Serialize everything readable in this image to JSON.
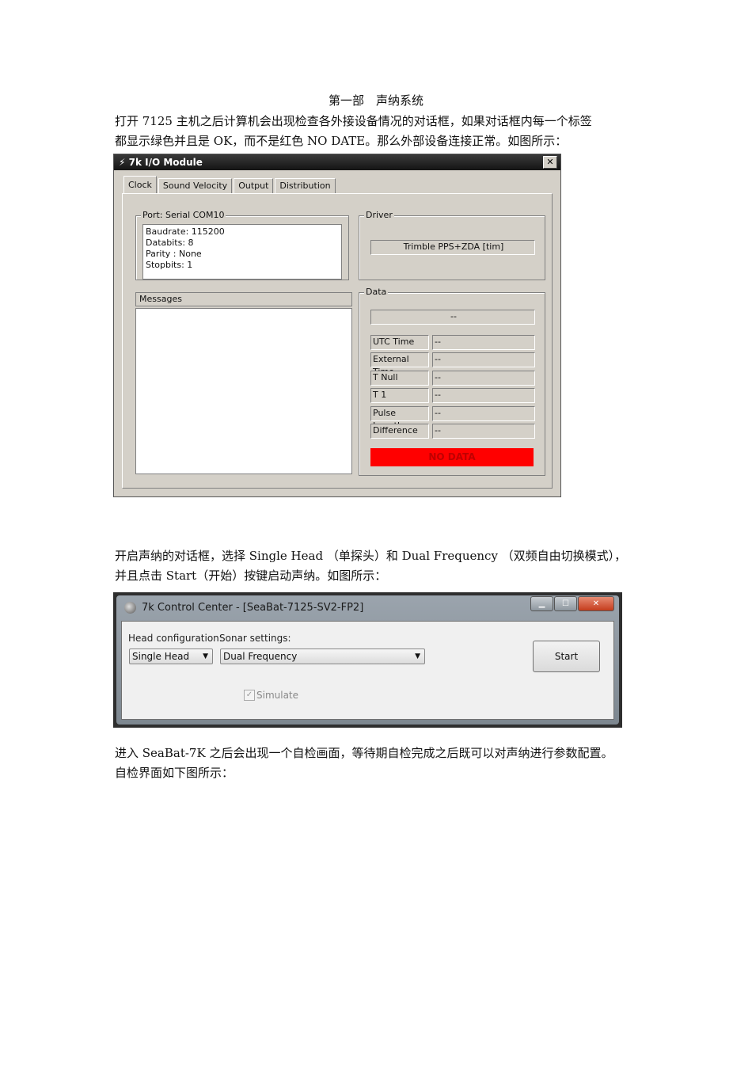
{
  "heading": "第一部　声纳系统",
  "para1": {
    "line1": "打开 7125 主机之后计算机会出现检查各外接设备情况的对话框，如果对话框内每一个标签",
    "line2": "都显示绿色并且是 OK，而不是红色 NO DATE。那么外部设备连接正常。如图所示："
  },
  "io_module": {
    "title": "7k I/O Module",
    "close": "✕",
    "tabs": [
      "Clock",
      "Sound Velocity",
      "Output",
      "Distribution"
    ],
    "port_label": "Port: Serial COM10",
    "port_lines": [
      "Baudrate: 115200",
      "Databits: 8",
      "Parity  : None",
      "Stopbits: 1"
    ],
    "driver_label": "Driver",
    "driver_value": "Trimble PPS+ZDA [tim]",
    "messages_label": "Messages",
    "data_label": "Data",
    "data_top": "--",
    "rows": [
      {
        "label": "UTC Time",
        "value": "--"
      },
      {
        "label": "External Time",
        "value": "--"
      },
      {
        "label": "T Null",
        "value": "--"
      },
      {
        "label": "T 1",
        "value": "--"
      },
      {
        "label": "Pulse Length",
        "value": "--"
      },
      {
        "label": "Difference",
        "value": "--"
      }
    ],
    "status": "NO DATA",
    "status_color": "#ff0000"
  },
  "para2": {
    "line1": "开启声纳的对话框，选择 Single Head （单探头）和 Dual Frequency （双频自由切换模式），",
    "line2": "并且点击 Start（开始）按键启动声纳。如图所示："
  },
  "control_center": {
    "title": "7k Control Center - [SeaBat-7125-SV2-FP2]",
    "min": "▁",
    "max": "☐",
    "close": "✕",
    "head_label": "Head configuration:",
    "head_value": "Single Head",
    "sonar_label": "Sonar settings:",
    "sonar_value": "Dual Frequency",
    "start": "Start",
    "simulate": "Simulate",
    "simulate_checked": "✓"
  },
  "para3": {
    "line1": "进入 SeaBat-7K 之后会出现一个自检画面，等待期自检完成之后既可以对声纳进行参数配置。",
    "line2": "自检界面如下图所示："
  }
}
